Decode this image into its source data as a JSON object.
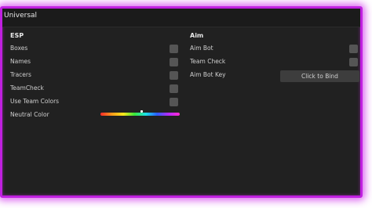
{
  "window": {
    "title": "Universal"
  },
  "esp": {
    "heading": "ESP",
    "rows": [
      {
        "label": "Boxes"
      },
      {
        "label": "Names"
      },
      {
        "label": "Tracers"
      },
      {
        "label": "TeamCheck"
      },
      {
        "label": "Use Team Colors"
      }
    ],
    "color_label": "Neutral Color"
  },
  "aim": {
    "heading": "Aim",
    "rows": [
      {
        "label": "Aim Bot"
      },
      {
        "label": "Team Check"
      }
    ],
    "key_label": "Aim Bot Key",
    "bind_button_label": "Click to Bind"
  },
  "colors": {
    "border": "#c020e0",
    "background": "#212121",
    "checkbox": "#555555"
  }
}
